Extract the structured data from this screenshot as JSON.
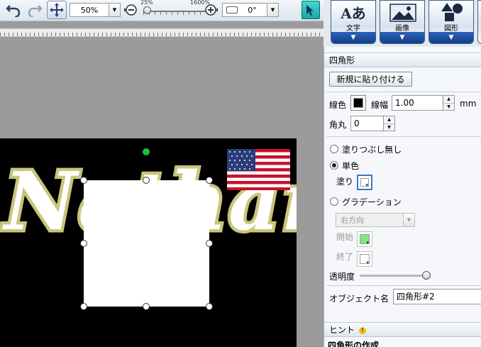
{
  "toolbar": {
    "zoom_value": "50%",
    "zoom_slider_min": "25%",
    "zoom_slider_max": "1600%",
    "zoom_slider_position": 0.0,
    "rotation_value": "0°"
  },
  "ribbon": {
    "text_button": {
      "icon_glyph": "Aあ",
      "label": "文字"
    },
    "image_button": {
      "label": "画像"
    },
    "shape_button": {
      "label": "図形"
    }
  },
  "canvas": {
    "background_text": "Nathan"
  },
  "panel": {
    "title": "四角形",
    "paste_new_button": "新規に貼り付ける",
    "line_color_label": "線色",
    "line_color": "#000000",
    "line_width_label": "線幅",
    "line_width_value": "1.00",
    "line_width_unit": "mm",
    "corner_label": "角丸",
    "corner_value": "0",
    "fill_none_label": "塗りつぶし無し",
    "fill_single_label": "単色",
    "fill_label": "塗り",
    "fill_color": "#ffffff",
    "gradient_label": "グラデーション",
    "gradient_direction": "右方向",
    "gradient_start_label": "開始",
    "gradient_start_color": "#7ee87e",
    "gradient_end_label": "終了",
    "gradient_end_color": "#ffffff",
    "opacity_label": "透明度",
    "opacity_value": 1.0,
    "object_name_label": "オブジェクト名",
    "object_name_value": "四角形#2",
    "hint_title": "ヒント",
    "hint_heading": "四角形の作成"
  },
  "colors": {
    "selection_handle_rotate": "#1fbf3a",
    "text_outline": "#c9c57a",
    "ribbon_blue": "#1f4f9e"
  }
}
